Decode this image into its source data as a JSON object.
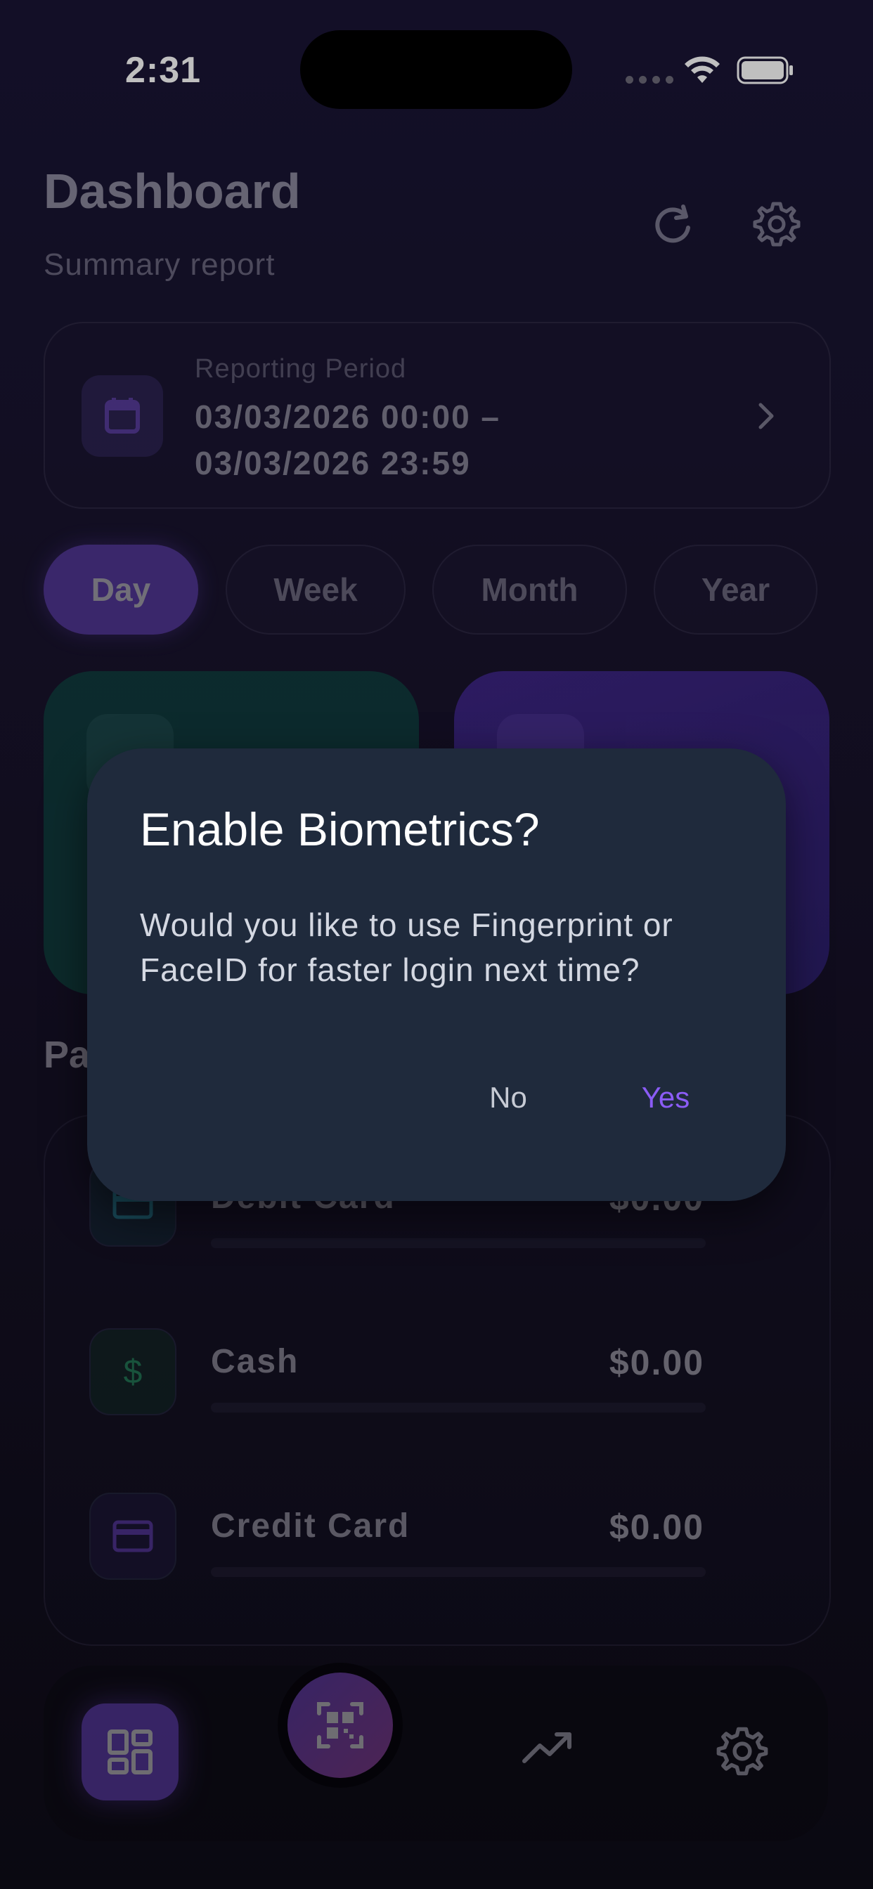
{
  "status_bar": {
    "time": "2:31"
  },
  "header": {
    "title": "Dashboard",
    "subtitle": "Summary report"
  },
  "period": {
    "label": "Reporting Period",
    "line1": "03/03/2026 00:00  –",
    "line2": "03/03/2026 23:59"
  },
  "range_tabs": [
    "Day",
    "Week",
    "Month",
    "Year"
  ],
  "active_tab": "Day",
  "section_peek": "Pa",
  "payments": [
    {
      "label": "Debit Card",
      "amount": "$0.00",
      "icon": "card-icon",
      "color": "#2aa3b8"
    },
    {
      "label": "Cash",
      "amount": "$0.00",
      "icon": "dollar-icon",
      "color": "#2fbf7a"
    },
    {
      "label": "Credit Card",
      "amount": "$0.00",
      "icon": "card-icon",
      "color": "#7b4fe0"
    }
  ],
  "dialog": {
    "title": "Enable Biometrics?",
    "body": "Would you like to use Fingerprint or FaceID for faster login next time?",
    "no_label": "No",
    "yes_label": "Yes"
  },
  "colors": {
    "accent": "#7b4fe0",
    "dialog_bg": "#1f2a3c",
    "yes": "#8b5cf6"
  }
}
